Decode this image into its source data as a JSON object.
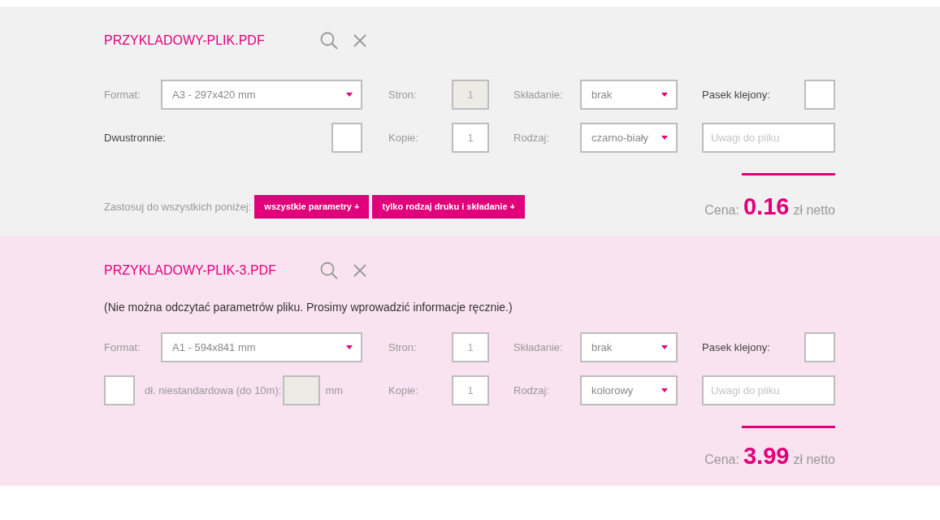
{
  "files": [
    {
      "name": "PRZYKLADOWY-PLIK.PDF",
      "warning": false,
      "format": {
        "label": "Format:",
        "value": "A3 - 297x420 mm"
      },
      "pages": {
        "label": "Stron:",
        "value": "1",
        "disabled": true
      },
      "folding": {
        "label": "Składanie:",
        "value": "brak"
      },
      "glued_strip": {
        "label": "Pasek klejony:",
        "checked": false
      },
      "option": {
        "kind": "duplex",
        "label": "Dwustronnie:",
        "checked": false
      },
      "copies": {
        "label": "Kopie:",
        "value": "1"
      },
      "print_type": {
        "label": "Rodzaj:",
        "value": "czarno-biały"
      },
      "notes": {
        "placeholder": "Uwagi do pliku"
      },
      "apply": {
        "label": "Zastosuj do wszystkich poniżej:",
        "buttons": [
          "wszystkie parametry +",
          "tylko rodzaj druku i składanie +"
        ]
      },
      "price": {
        "label": "Cena:",
        "amount": "0.16",
        "unit": "zł netto"
      }
    },
    {
      "name": "PRZYKLADOWY-PLIK-3.PDF",
      "warning": true,
      "message": "(Nie można odczytać parametrów pliku. Prosimy wprowadzić informacje ręcznie.)",
      "format": {
        "label": "Format:",
        "value": "A1 - 594x841 mm"
      },
      "pages": {
        "label": "Stron:",
        "value": "1",
        "disabled": false
      },
      "folding": {
        "label": "Składanie:",
        "value": "brak"
      },
      "glued_strip": {
        "label": "Pasek klejony:",
        "checked": false
      },
      "option": {
        "kind": "custom_length",
        "label": "dł. niestandardowa (do 10m):",
        "unit": "mm",
        "checked": false,
        "length_disabled": true
      },
      "copies": {
        "label": "Kopie:",
        "value": "1"
      },
      "print_type": {
        "label": "Rodzaj:",
        "value": "kolorowy"
      },
      "notes": {
        "placeholder": "Uwagi do pliku"
      },
      "price": {
        "label": "Cena:",
        "amount": "3.99",
        "unit": "zł netto"
      }
    }
  ]
}
